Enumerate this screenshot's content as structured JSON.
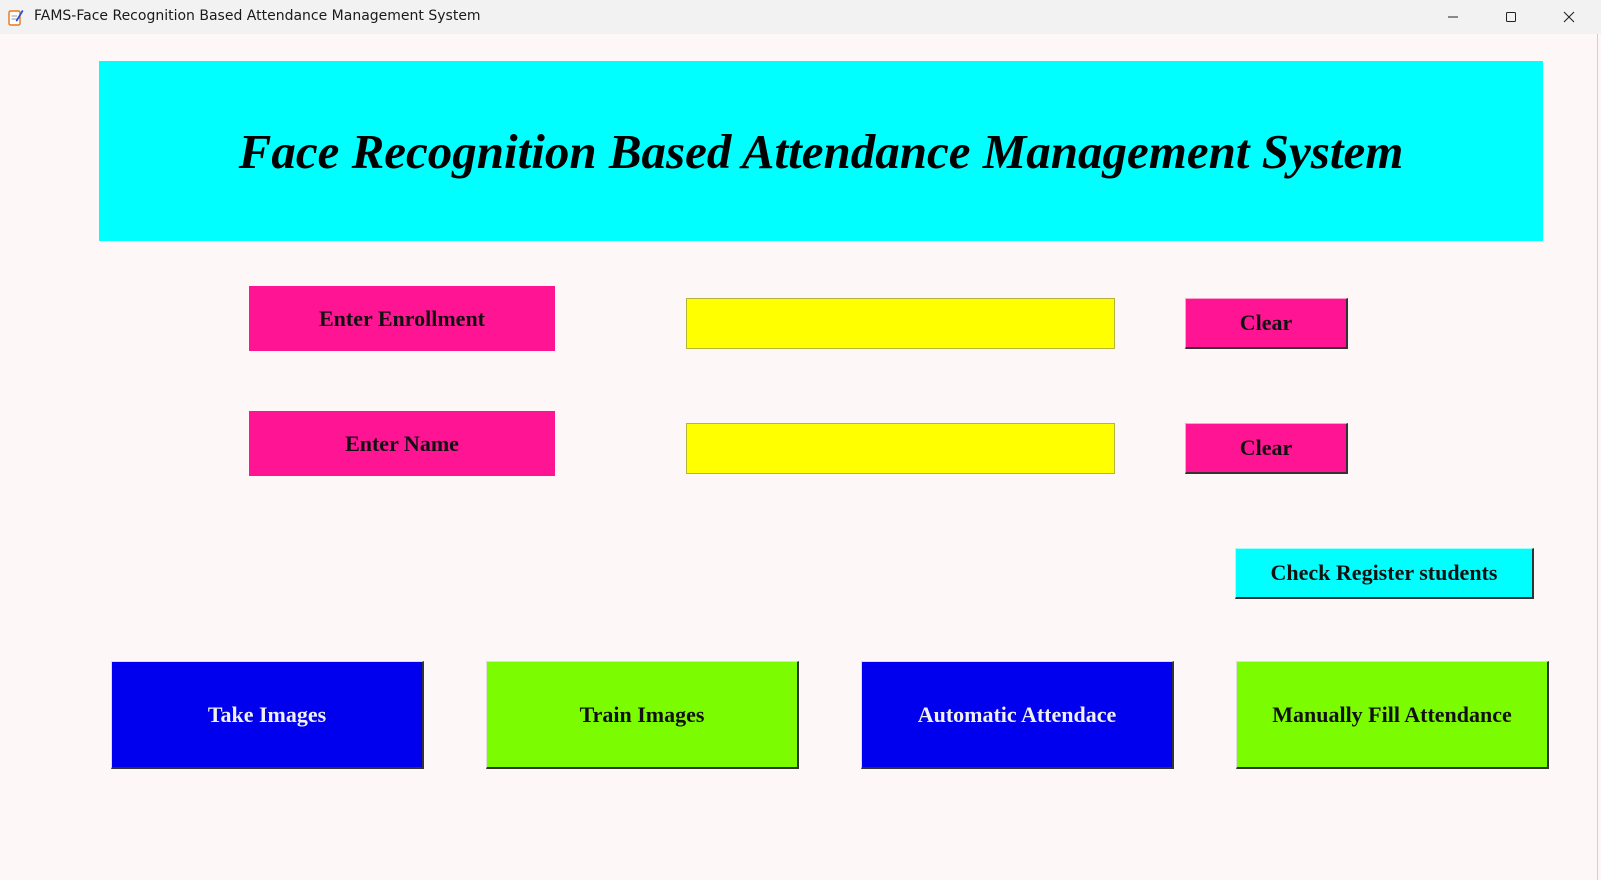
{
  "window": {
    "title": "FAMS-Face Recognition Based Attendance Management System",
    "icons": [
      "notepad-icon",
      "minimize-icon",
      "maximize-icon",
      "close-icon"
    ]
  },
  "header": {
    "title": "Face Recognition Based Attendance Management System"
  },
  "form": {
    "enrollment_label": "Enter Enrollment",
    "enrollment_value": "",
    "name_label": "Enter Name",
    "name_value": "",
    "clear_label": "Clear"
  },
  "check_register_label": "Check Register students",
  "actions": {
    "take_images": "Take Images",
    "train_images": "Train Images",
    "automatic_attendance": "Automatic Attendace",
    "manual_attendance": "Manually Fill Attendance"
  },
  "colors": {
    "header_bg": "#00ffff",
    "label_bg": "#ff1493",
    "input_bg": "#ffff00",
    "blue_button": "#0000ee",
    "green_button": "#7cfc00"
  }
}
